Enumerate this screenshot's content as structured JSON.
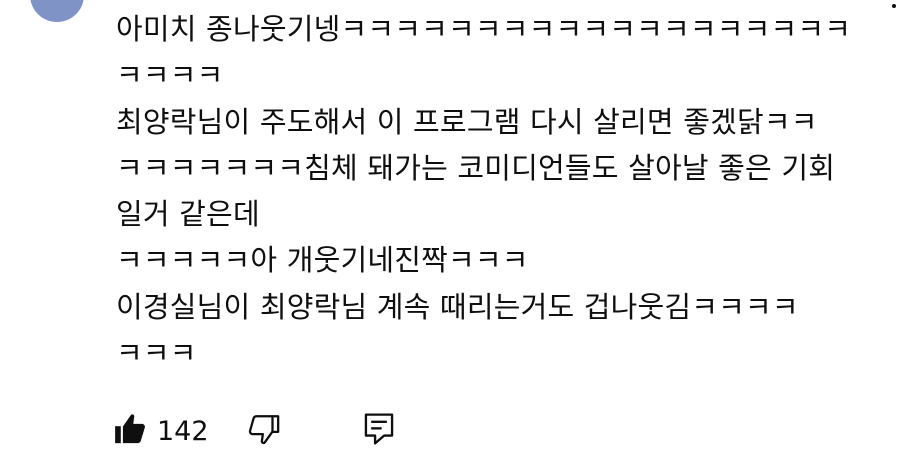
{
  "comment": {
    "lines": [
      "아미치 종나웃기넹ㅋㅋㅋㅋㅋㅋㅋㅋㅋㅋㅋㅋㅋㅋㅋㅋㅋㅋㅋ",
      "ㅋㅋㅋㅋ",
      "최양락님이 주도해서 이 프로그램 다시 살리면 좋겠닭ㅋㅋ",
      "ㅋㅋㅋㅋㅋㅋㅋ침체 돼가는 코미디언들도 살아날 좋은 기회",
      "일거 같은데",
      "ㅋㅋㅋㅋㅋ아 개웃기네진짝ㅋㅋㅋ",
      "이경실님이 최양락님 계속 때리는거도 겁나웃김ㅋㅋㅋㅋ",
      "ㅋㅋㅋ"
    ]
  },
  "actions": {
    "like_count": "142",
    "like_icon": "thumbs-up-filled",
    "dislike_icon": "thumbs-down-outline",
    "reply_icon": "comment-outline"
  },
  "colors": {
    "text": "#0f0f0f",
    "background": "#ffffff",
    "avatar": "#7f93c6"
  }
}
